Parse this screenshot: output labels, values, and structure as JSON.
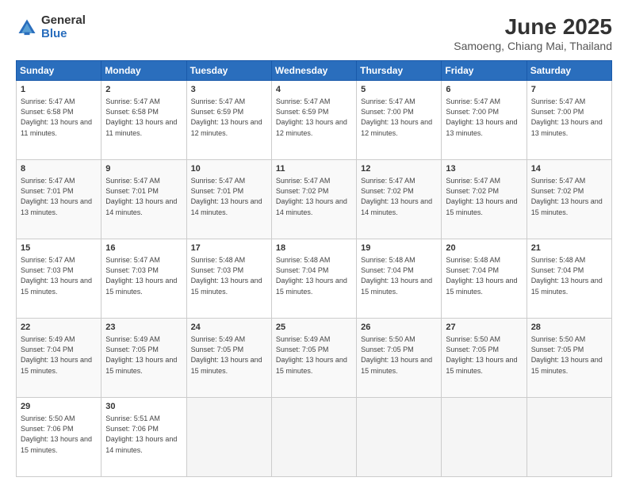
{
  "logo": {
    "general": "General",
    "blue": "Blue"
  },
  "title": {
    "month": "June 2025",
    "location": "Samoeng, Chiang Mai, Thailand"
  },
  "days_of_week": [
    "Sunday",
    "Monday",
    "Tuesday",
    "Wednesday",
    "Thursday",
    "Friday",
    "Saturday"
  ],
  "weeks": [
    [
      {
        "day": "1",
        "sunrise": "5:47 AM",
        "sunset": "6:58 PM",
        "daylight": "13 hours and 11 minutes."
      },
      {
        "day": "2",
        "sunrise": "5:47 AM",
        "sunset": "6:58 PM",
        "daylight": "13 hours and 11 minutes."
      },
      {
        "day": "3",
        "sunrise": "5:47 AM",
        "sunset": "6:59 PM",
        "daylight": "13 hours and 12 minutes."
      },
      {
        "day": "4",
        "sunrise": "5:47 AM",
        "sunset": "6:59 PM",
        "daylight": "13 hours and 12 minutes."
      },
      {
        "day": "5",
        "sunrise": "5:47 AM",
        "sunset": "7:00 PM",
        "daylight": "13 hours and 12 minutes."
      },
      {
        "day": "6",
        "sunrise": "5:47 AM",
        "sunset": "7:00 PM",
        "daylight": "13 hours and 13 minutes."
      },
      {
        "day": "7",
        "sunrise": "5:47 AM",
        "sunset": "7:00 PM",
        "daylight": "13 hours and 13 minutes."
      }
    ],
    [
      {
        "day": "8",
        "sunrise": "5:47 AM",
        "sunset": "7:01 PM",
        "daylight": "13 hours and 13 minutes."
      },
      {
        "day": "9",
        "sunrise": "5:47 AM",
        "sunset": "7:01 PM",
        "daylight": "13 hours and 14 minutes."
      },
      {
        "day": "10",
        "sunrise": "5:47 AM",
        "sunset": "7:01 PM",
        "daylight": "13 hours and 14 minutes."
      },
      {
        "day": "11",
        "sunrise": "5:47 AM",
        "sunset": "7:02 PM",
        "daylight": "13 hours and 14 minutes."
      },
      {
        "day": "12",
        "sunrise": "5:47 AM",
        "sunset": "7:02 PM",
        "daylight": "13 hours and 14 minutes."
      },
      {
        "day": "13",
        "sunrise": "5:47 AM",
        "sunset": "7:02 PM",
        "daylight": "13 hours and 15 minutes."
      },
      {
        "day": "14",
        "sunrise": "5:47 AM",
        "sunset": "7:02 PM",
        "daylight": "13 hours and 15 minutes."
      }
    ],
    [
      {
        "day": "15",
        "sunrise": "5:47 AM",
        "sunset": "7:03 PM",
        "daylight": "13 hours and 15 minutes."
      },
      {
        "day": "16",
        "sunrise": "5:47 AM",
        "sunset": "7:03 PM",
        "daylight": "13 hours and 15 minutes."
      },
      {
        "day": "17",
        "sunrise": "5:48 AM",
        "sunset": "7:03 PM",
        "daylight": "13 hours and 15 minutes."
      },
      {
        "day": "18",
        "sunrise": "5:48 AM",
        "sunset": "7:04 PM",
        "daylight": "13 hours and 15 minutes."
      },
      {
        "day": "19",
        "sunrise": "5:48 AM",
        "sunset": "7:04 PM",
        "daylight": "13 hours and 15 minutes."
      },
      {
        "day": "20",
        "sunrise": "5:48 AM",
        "sunset": "7:04 PM",
        "daylight": "13 hours and 15 minutes."
      },
      {
        "day": "21",
        "sunrise": "5:48 AM",
        "sunset": "7:04 PM",
        "daylight": "13 hours and 15 minutes."
      }
    ],
    [
      {
        "day": "22",
        "sunrise": "5:49 AM",
        "sunset": "7:04 PM",
        "daylight": "13 hours and 15 minutes."
      },
      {
        "day": "23",
        "sunrise": "5:49 AM",
        "sunset": "7:05 PM",
        "daylight": "13 hours and 15 minutes."
      },
      {
        "day": "24",
        "sunrise": "5:49 AM",
        "sunset": "7:05 PM",
        "daylight": "13 hours and 15 minutes."
      },
      {
        "day": "25",
        "sunrise": "5:49 AM",
        "sunset": "7:05 PM",
        "daylight": "13 hours and 15 minutes."
      },
      {
        "day": "26",
        "sunrise": "5:50 AM",
        "sunset": "7:05 PM",
        "daylight": "13 hours and 15 minutes."
      },
      {
        "day": "27",
        "sunrise": "5:50 AM",
        "sunset": "7:05 PM",
        "daylight": "13 hours and 15 minutes."
      },
      {
        "day": "28",
        "sunrise": "5:50 AM",
        "sunset": "7:05 PM",
        "daylight": "13 hours and 15 minutes."
      }
    ],
    [
      {
        "day": "29",
        "sunrise": "5:50 AM",
        "sunset": "7:06 PM",
        "daylight": "13 hours and 15 minutes."
      },
      {
        "day": "30",
        "sunrise": "5:51 AM",
        "sunset": "7:06 PM",
        "daylight": "13 hours and 14 minutes."
      },
      null,
      null,
      null,
      null,
      null
    ]
  ]
}
